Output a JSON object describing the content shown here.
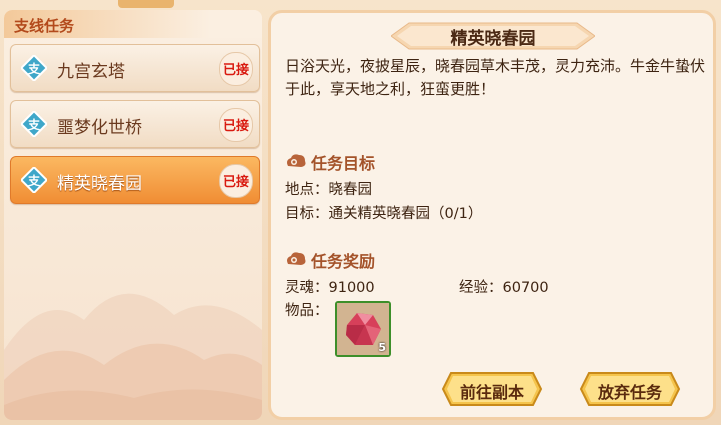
{
  "left": {
    "header": "支线任务",
    "quests": [
      {
        "badge": "支",
        "name": "九宫玄塔",
        "status": "已接",
        "selected": false
      },
      {
        "badge": "支",
        "name": "噩梦化世桥",
        "status": "已接",
        "selected": false
      },
      {
        "badge": "支",
        "name": "精英晓春园",
        "status": "已接",
        "selected": true
      }
    ]
  },
  "detail": {
    "title": "精英晓春园",
    "description": "日浴天光，夜披星辰，晓春园草木丰茂，灵力充沛。牛金牛蛰伏于此，享天地之利，狂蛮更胜！",
    "objective_title": "任务目标",
    "location": "地点：晓春园",
    "target": "目标：通关精英晓春园（0/1）",
    "reward_title": "任务奖励",
    "soul": "灵魂：91000",
    "exp": "经验：60700",
    "items_label": "物品：",
    "item": {
      "icon": "red-crystal-icon",
      "count": "5"
    }
  },
  "buttons": {
    "go": "前往副本",
    "abandon": "放弃任务"
  },
  "colors": {
    "accent": "#f08d34",
    "status_red": "#d91a10",
    "section_title": "#a4532a",
    "item_border": "#3d8f2a"
  }
}
